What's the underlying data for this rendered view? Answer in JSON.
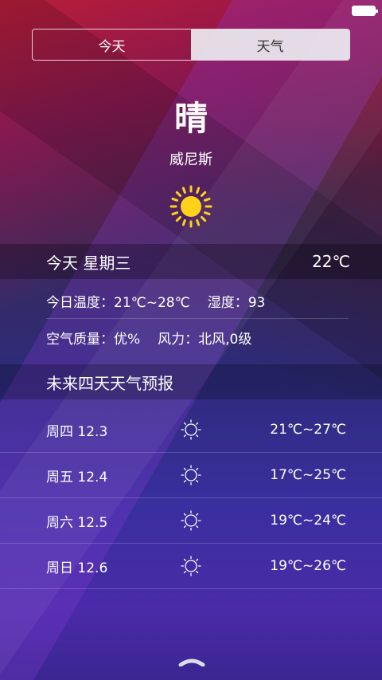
{
  "tabs": [
    {
      "label": "今天",
      "active": true
    },
    {
      "label": "天气",
      "active": false
    }
  ],
  "current": {
    "condition": "晴",
    "city": "威尼斯",
    "icon": "sun-icon"
  },
  "today": {
    "day": "今天 星期三",
    "temperature": "22℃",
    "temp_range": "今日温度：21℃~28℃",
    "humidity": "湿度：93",
    "air_quality": "空气质量：优%",
    "wind": "风力：北风,0级"
  },
  "forecast": {
    "title": "未来四天天气预报",
    "days": [
      {
        "day": "周四 12.3",
        "icon": "sun-outline-icon",
        "temp": "21℃~27℃"
      },
      {
        "day": "周五 12.4",
        "icon": "sun-outline-icon",
        "temp": "17℃~25℃"
      },
      {
        "day": "周六 12.5",
        "icon": "sun-outline-icon",
        "temp": "19℃~24℃"
      },
      {
        "day": "周日 12.6",
        "icon": "sun-outline-icon",
        "temp": "19℃~26℃"
      }
    ]
  },
  "colors": {
    "sun": "#FFD21A",
    "tab_inactive_bg": "#EBEBF0"
  }
}
